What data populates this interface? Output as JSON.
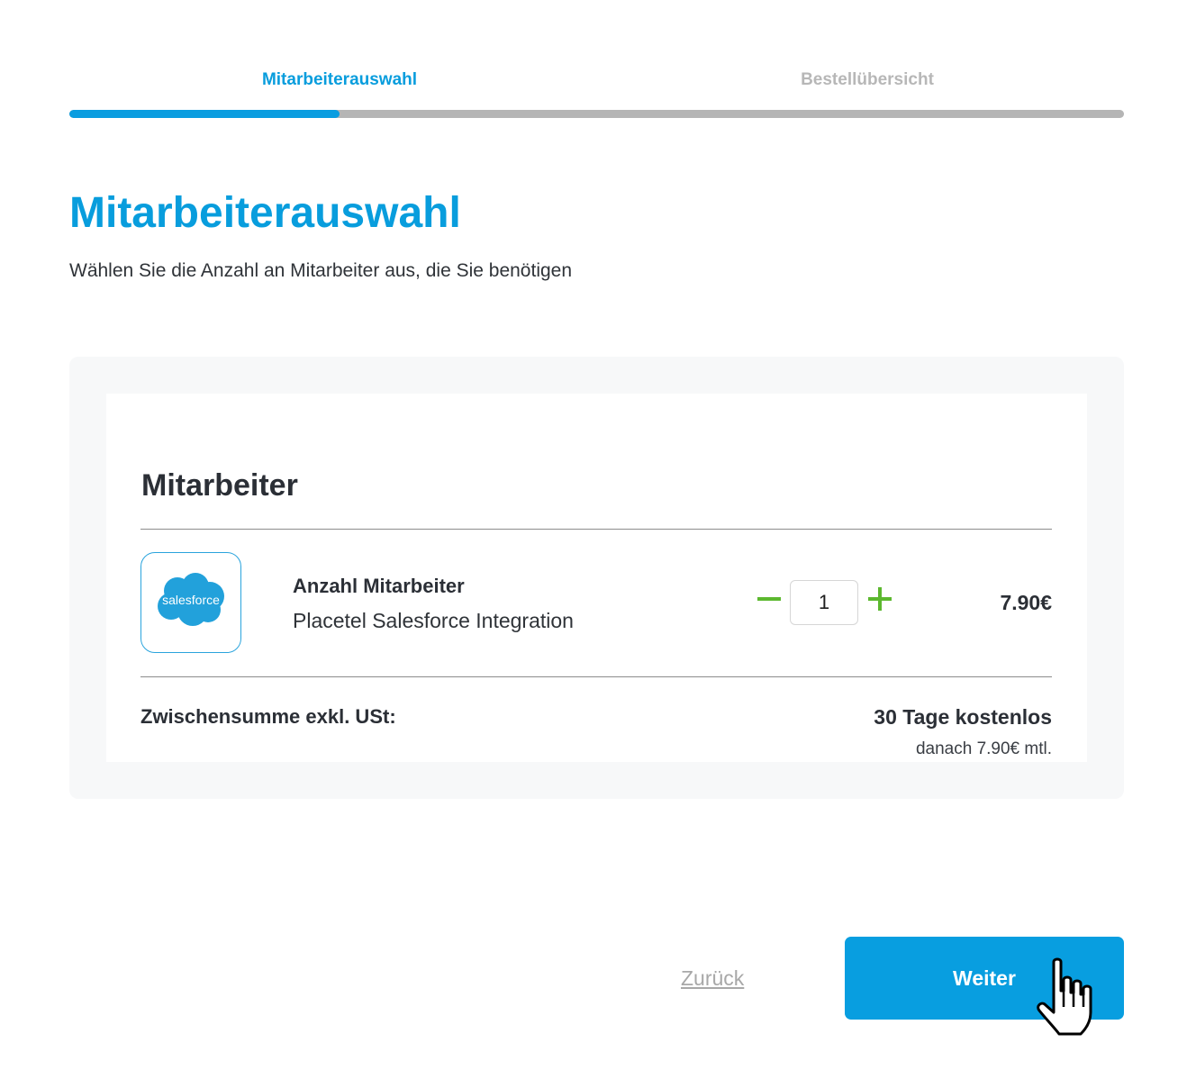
{
  "stepper": {
    "steps": [
      {
        "label": "Mitarbeiterauswahl",
        "state": "active"
      },
      {
        "label": "Bestellübersicht",
        "state": "inactive"
      }
    ],
    "progress_fraction": 0.256,
    "active_color": "#089ddd",
    "inactive_color": "#b7b7b7"
  },
  "header": {
    "title": "Mitarbeiterauswahl",
    "subtitle": "Wählen Sie die Anzahl an Mitarbeiter aus, die Sie benötigen"
  },
  "card": {
    "title": "Mitarbeiter",
    "item": {
      "logo_icon": "salesforce-cloud-icon",
      "logo_text": "salesforce",
      "title": "Anzahl Mitarbeiter",
      "subtitle": "Placetel Salesforce Integration",
      "quantity": "1",
      "decrement_icon": "minus-icon",
      "increment_icon": "plus-icon",
      "stepper_color": "#5cb82f",
      "price": "7.90€"
    },
    "subtotal": {
      "label": "Zwischensumme exkl. USt:",
      "trial": "30 Tage kostenlos",
      "after": "danach 7.90€ mtl."
    }
  },
  "footer": {
    "back_label": "Zurück",
    "next_label": "Weiter",
    "primary_color": "#089ee0"
  },
  "cursor_icon": "hand-pointer-icon"
}
